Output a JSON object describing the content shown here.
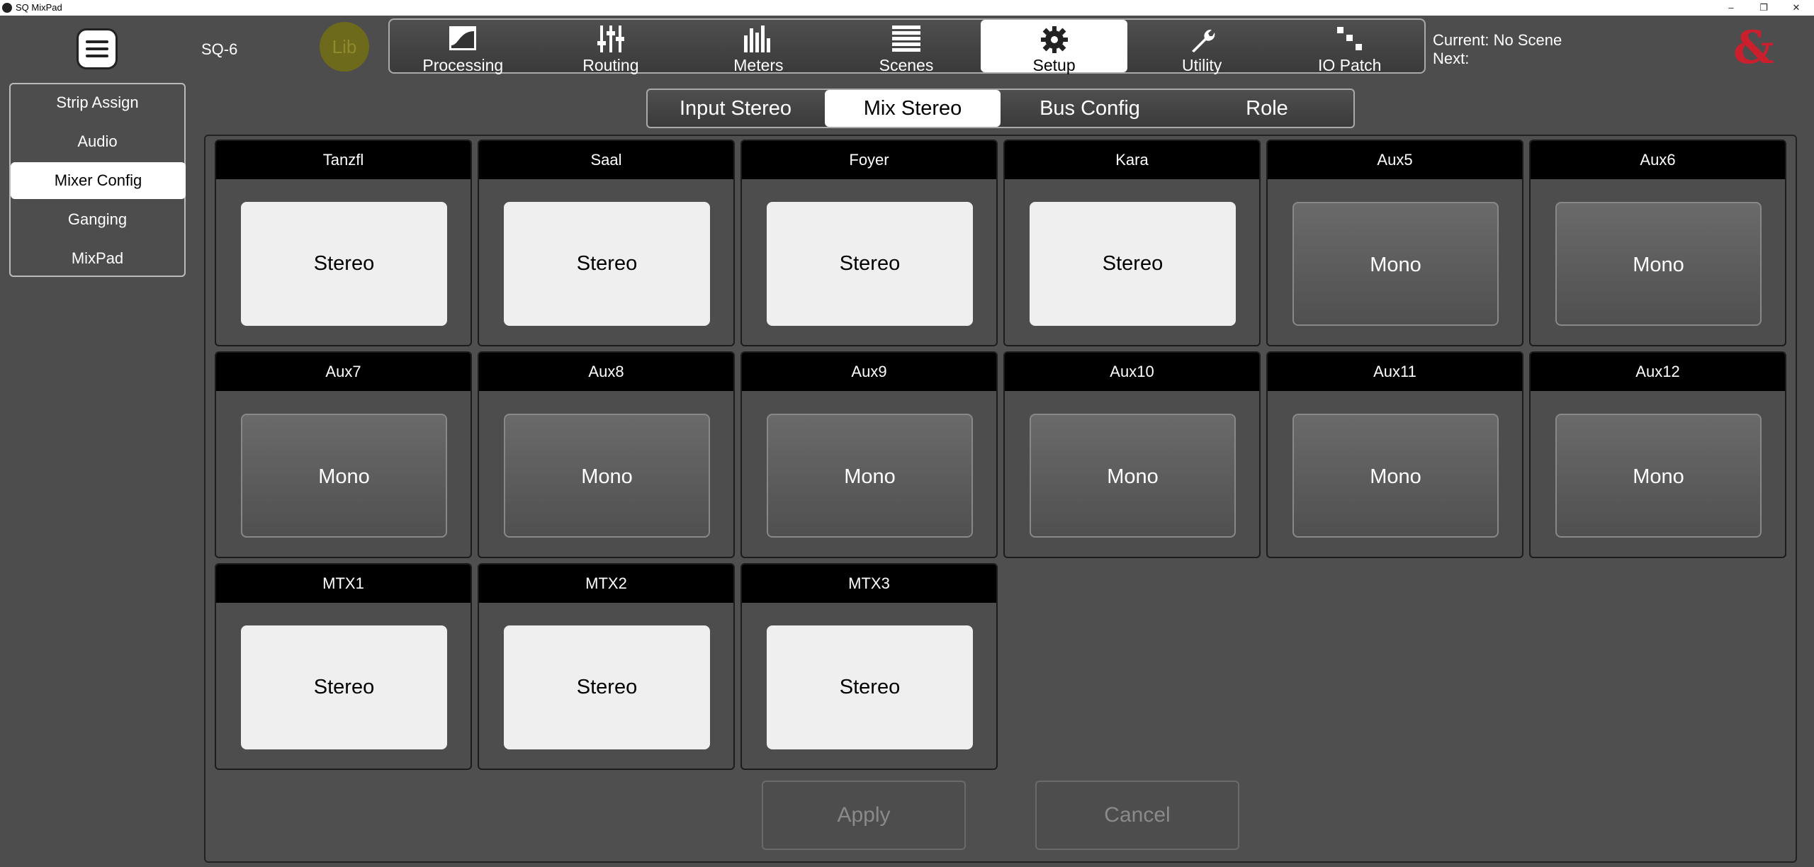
{
  "window": {
    "title": "SQ MixPad"
  },
  "header": {
    "device_name": "SQ-6",
    "lib_label": "Lib",
    "scene_current": "Current: No Scene",
    "scene_next": "Next:",
    "brand_symbol": "&",
    "brand_color": "#cc1f2e"
  },
  "main_tabs": [
    {
      "label": "Processing",
      "icon": "processing-icon"
    },
    {
      "label": "Routing",
      "icon": "routing-icon"
    },
    {
      "label": "Meters",
      "icon": "meters-icon"
    },
    {
      "label": "Scenes",
      "icon": "scenes-icon"
    },
    {
      "label": "Setup",
      "icon": "gear-icon",
      "active": true
    },
    {
      "label": "Utility",
      "icon": "wrench-icon"
    },
    {
      "label": "IO Patch",
      "icon": "io-patch-icon"
    }
  ],
  "sidebar": {
    "items": [
      {
        "label": "Strip Assign"
      },
      {
        "label": "Audio"
      },
      {
        "label": "Mixer Config",
        "active": true
      },
      {
        "label": "Ganging"
      },
      {
        "label": "MixPad"
      }
    ]
  },
  "sub_tabs": [
    {
      "label": "Input Stereo"
    },
    {
      "label": "Mix Stereo",
      "active": true
    },
    {
      "label": "Bus Config"
    },
    {
      "label": "Role"
    }
  ],
  "mixes": [
    {
      "name": "Tanzfl",
      "mode": "Stereo"
    },
    {
      "name": "Saal",
      "mode": "Stereo"
    },
    {
      "name": "Foyer",
      "mode": "Stereo"
    },
    {
      "name": "Kara",
      "mode": "Stereo"
    },
    {
      "name": "Aux5",
      "mode": "Mono"
    },
    {
      "name": "Aux6",
      "mode": "Mono"
    },
    {
      "name": "Aux7",
      "mode": "Mono"
    },
    {
      "name": "Aux8",
      "mode": "Mono"
    },
    {
      "name": "Aux9",
      "mode": "Mono"
    },
    {
      "name": "Aux10",
      "mode": "Mono"
    },
    {
      "name": "Aux11",
      "mode": "Mono"
    },
    {
      "name": "Aux12",
      "mode": "Mono"
    },
    {
      "name": "MTX1",
      "mode": "Stereo"
    },
    {
      "name": "MTX2",
      "mode": "Stereo"
    },
    {
      "name": "MTX3",
      "mode": "Stereo"
    }
  ],
  "actions": {
    "apply": "Apply",
    "cancel": "Cancel"
  }
}
